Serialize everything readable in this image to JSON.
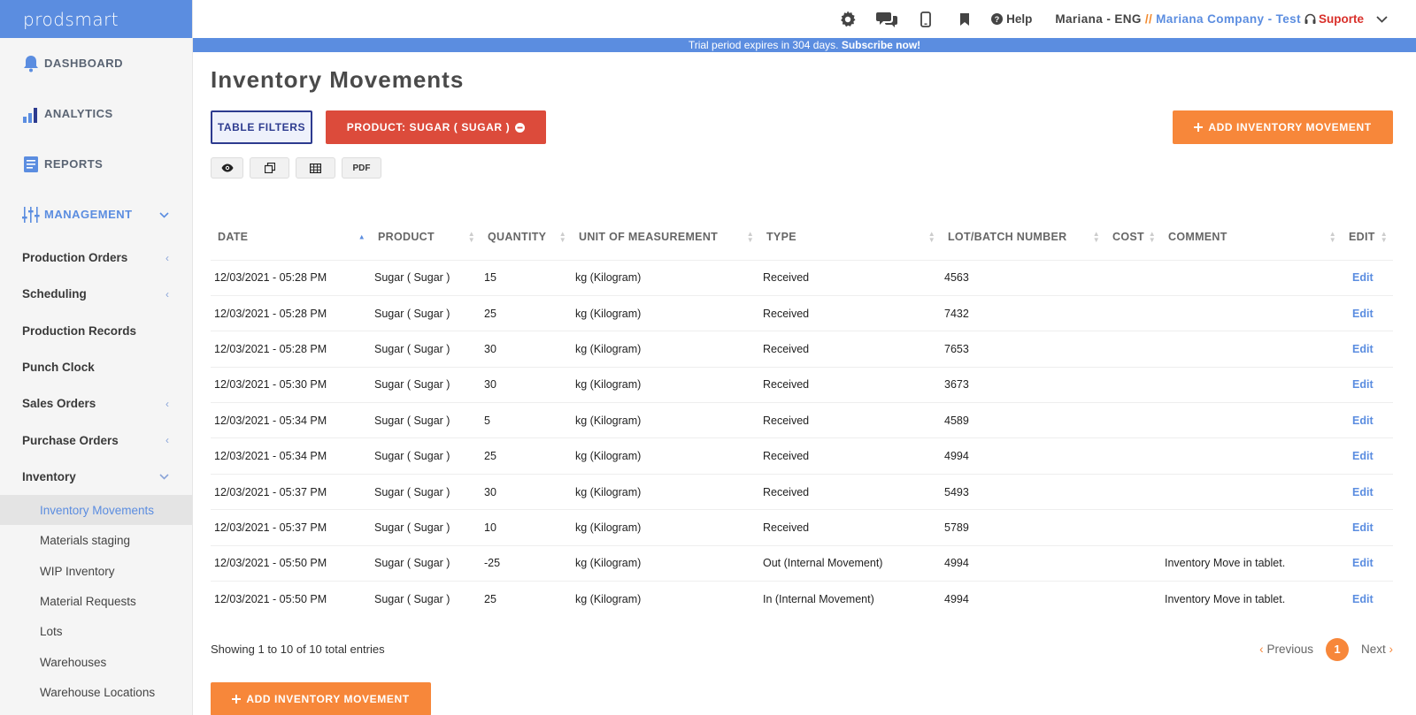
{
  "app": {
    "logo": "prodsmart"
  },
  "sidebar": {
    "top": [
      {
        "label": "DASHBOARD",
        "icon": "bell-icon"
      },
      {
        "label": "ANALYTICS",
        "icon": "bar-chart-icon"
      },
      {
        "label": "REPORTS",
        "icon": "document-icon"
      },
      {
        "label": "MANAGEMENT",
        "icon": "sliders-icon"
      }
    ],
    "management": [
      {
        "label": "Production Orders",
        "chevron": "‹"
      },
      {
        "label": "Scheduling",
        "chevron": "‹"
      },
      {
        "label": "Production Records",
        "chevron": ""
      },
      {
        "label": "Punch Clock",
        "chevron": ""
      },
      {
        "label": "Sales Orders",
        "chevron": "‹"
      },
      {
        "label": "Purchase Orders",
        "chevron": "‹"
      },
      {
        "label": "Inventory",
        "chevron": "⌄"
      }
    ],
    "inventory_sub": [
      "Inventory Movements",
      "Materials staging",
      "WIP Inventory",
      "Material Requests",
      "Lots",
      "Warehouses",
      "Warehouse Locations"
    ]
  },
  "topbar": {
    "help": "Help",
    "user": "Mariana - ENG",
    "separator": "//",
    "company": "Mariana Company - Test",
    "support": "Suporte"
  },
  "trial": {
    "text": "Trial period expires in 304 days. ",
    "cta": "Subscribe now!"
  },
  "page": {
    "title": "Inventory Movements",
    "filters_label": "TABLE FILTERS",
    "product_filter_label": "PRODUCT: SUGAR ( SUGAR )",
    "add_label": "ADD INVENTORY MOVEMENT",
    "pdf_label": "PDF"
  },
  "table": {
    "headers": [
      "DATE",
      "PRODUCT",
      "QUANTITY",
      "UNIT OF MEASUREMENT",
      "TYPE",
      "LOT/BATCH NUMBER",
      "COST",
      "COMMENT",
      "EDIT"
    ],
    "rows": [
      [
        "12/03/2021 - 05:28 PM",
        "Sugar ( Sugar )",
        "15",
        "kg (Kilogram)",
        "Received",
        "4563",
        "",
        "",
        "Edit"
      ],
      [
        "12/03/2021 - 05:28 PM",
        "Sugar ( Sugar )",
        "25",
        "kg (Kilogram)",
        "Received",
        "7432",
        "",
        "",
        "Edit"
      ],
      [
        "12/03/2021 - 05:28 PM",
        "Sugar ( Sugar )",
        "30",
        "kg (Kilogram)",
        "Received",
        "7653",
        "",
        "",
        "Edit"
      ],
      [
        "12/03/2021 - 05:30 PM",
        "Sugar ( Sugar )",
        "30",
        "kg (Kilogram)",
        "Received",
        "3673",
        "",
        "",
        "Edit"
      ],
      [
        "12/03/2021 - 05:34 PM",
        "Sugar ( Sugar )",
        "5",
        "kg (Kilogram)",
        "Received",
        "4589",
        "",
        "",
        "Edit"
      ],
      [
        "12/03/2021 - 05:34 PM",
        "Sugar ( Sugar )",
        "25",
        "kg (Kilogram)",
        "Received",
        "4994",
        "",
        "",
        "Edit"
      ],
      [
        "12/03/2021 - 05:37 PM",
        "Sugar ( Sugar )",
        "30",
        "kg (Kilogram)",
        "Received",
        "5493",
        "",
        "",
        "Edit"
      ],
      [
        "12/03/2021 - 05:37 PM",
        "Sugar ( Sugar )",
        "10",
        "kg (Kilogram)",
        "Received",
        "5789",
        "",
        "",
        "Edit"
      ],
      [
        "12/03/2021 - 05:50 PM",
        "Sugar ( Sugar )",
        "-25",
        "kg (Kilogram)",
        "Out (Internal Movement)",
        "4994",
        "",
        "Inventory Move in tablet.",
        "Edit"
      ],
      [
        "12/03/2021 - 05:50 PM",
        "Sugar ( Sugar )",
        "25",
        "kg (Kilogram)",
        "In (Internal Movement)",
        "4994",
        "",
        "Inventory Move in tablet.",
        "Edit"
      ]
    ]
  },
  "footer": {
    "showing": "Showing 1 to 10 of 10 total entries",
    "previous": "Previous",
    "page": "1",
    "next": "Next"
  },
  "colors": {
    "primary": "#5b8de0",
    "accent": "#f7873a",
    "danger": "#dc4b3b",
    "navy": "#2d3b8f"
  }
}
